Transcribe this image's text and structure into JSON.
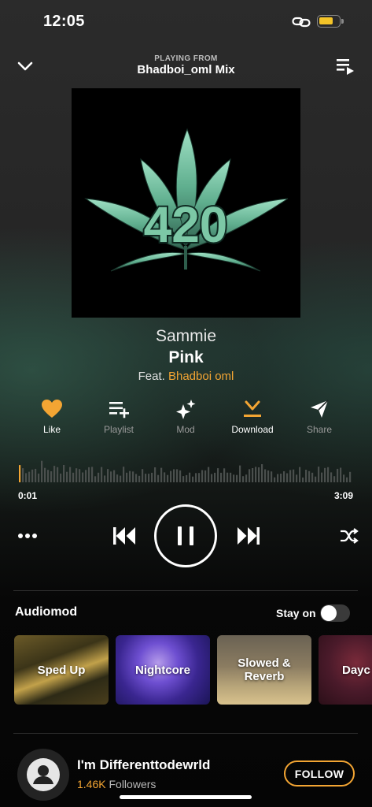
{
  "status": {
    "time": "12:05",
    "icons": [
      "link-icon",
      "battery-icon"
    ],
    "battery_color": "#f4c428"
  },
  "header": {
    "playing_from_label": "PLAYING FROM",
    "mix_name": "Bhadboi_oml Mix",
    "icons": [
      "chevron-down-icon",
      "queue-icon"
    ]
  },
  "artwork": {
    "text": "420",
    "icon": "cannabis-leaf-icon"
  },
  "song": {
    "artist": "Sammie",
    "title": "Pink",
    "feat_prefix": "Feat.",
    "feat_artist": "Bhadboi oml"
  },
  "actions": [
    {
      "label": "Like",
      "icon": "heart-icon",
      "active": true
    },
    {
      "label": "Playlist",
      "icon": "add-to-playlist-icon",
      "active": false
    },
    {
      "label": "Mod",
      "icon": "sparkles-icon",
      "active": false
    },
    {
      "label": "Download",
      "icon": "download-icon",
      "active": true
    },
    {
      "label": "Share",
      "icon": "share-icon",
      "active": false
    }
  ],
  "player": {
    "elapsed": "0:01",
    "duration": "3:09",
    "progress_fraction": 0.005,
    "accent": "#f3a533"
  },
  "controls": [
    "more-icon",
    "previous-icon",
    "pause-icon",
    "next-icon",
    "shuffle-icon"
  ],
  "audiomod": {
    "title": "Audiomod",
    "stay_on_label": "Stay on",
    "stay_on": false,
    "cards": [
      {
        "label": "Sped Up"
      },
      {
        "label": "Nightcore"
      },
      {
        "label": "Slowed & Reverb"
      },
      {
        "label": "Dayc"
      }
    ]
  },
  "artist_footer": {
    "name": "I'm Differenttodewrld",
    "followers_count": "1.46K",
    "followers_label": "Followers",
    "follow_label": "FOLLOW"
  }
}
